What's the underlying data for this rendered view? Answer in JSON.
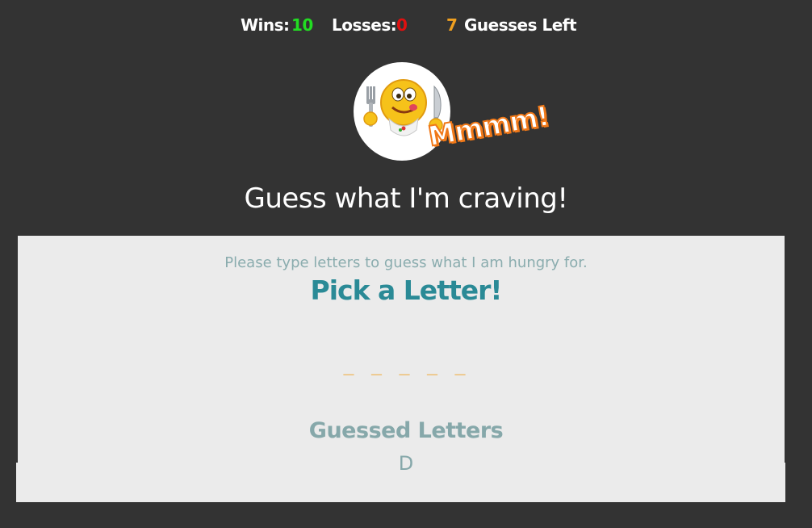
{
  "stats": {
    "wins_label": "Wins:",
    "wins_value": "10",
    "losses_label": "Losses:",
    "losses_value": "0",
    "guesses_value": "7",
    "guesses_label": "Guesses Left"
  },
  "logo": {
    "text": "Mmmm!",
    "icon": "hungry-emoji-with-fork-and-knife"
  },
  "headline": "Guess what I'm craving!",
  "game": {
    "instructions": "Please type letters to guess what I am hungry for.",
    "prompt": "Pick a Letter!",
    "word_display": "_ _ _ _ _",
    "guessed_title": "Guessed Letters",
    "guessed_letters": "D"
  },
  "colors": {
    "background": "#333333",
    "panel": "#ebebeb",
    "wins": "#22dd22",
    "losses": "#e01010",
    "guesses": "#f0a020",
    "teal": "#2a8a96",
    "muted": "#86a8aa",
    "logo_outline": "#f07818"
  }
}
